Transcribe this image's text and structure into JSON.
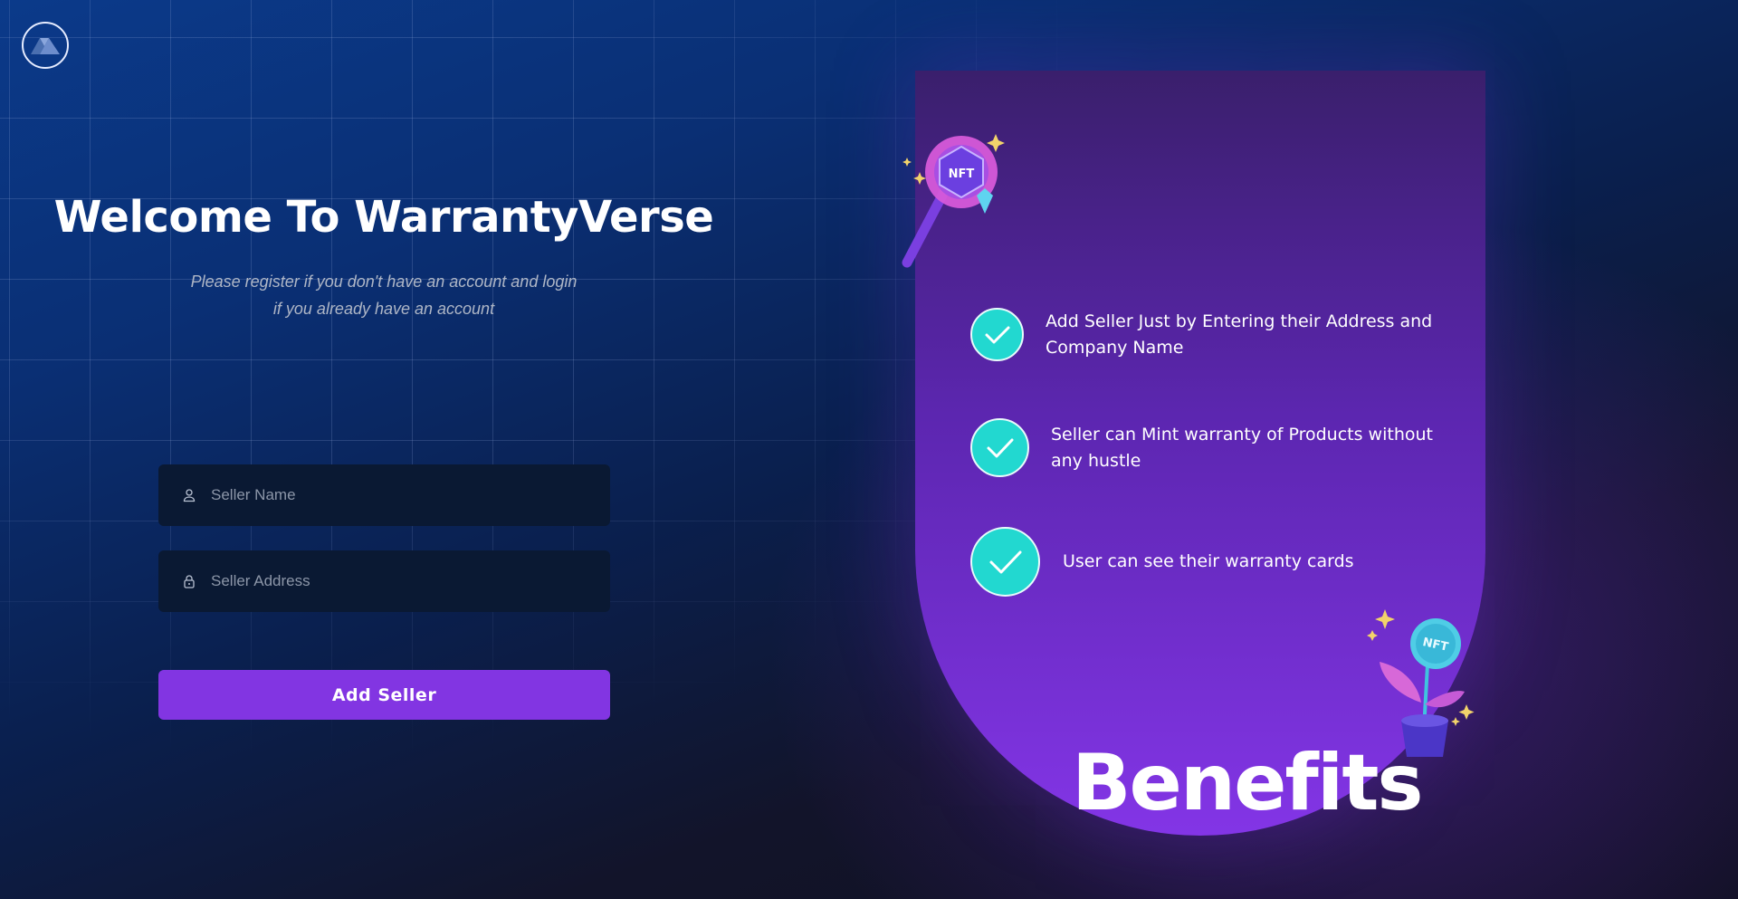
{
  "logo": {
    "icon": "warrantyverse-logo-icon"
  },
  "hero": {
    "title": "Welcome To WarrantyVerse",
    "subtitle": "Please register if you don't have an account and login if you already have an account"
  },
  "form": {
    "seller_name": {
      "placeholder": "Seller Name",
      "value": "",
      "icon": "user-icon"
    },
    "seller_address": {
      "placeholder": "Seller Address",
      "value": "",
      "icon": "lock-icon"
    },
    "submit_label": "Add Seller"
  },
  "benefits": {
    "title": "Benefits",
    "items": [
      {
        "text": "Add Seller Just by Entering their Address and Company Name",
        "icon": "check-icon"
      },
      {
        "text": "Seller can Mint warranty of Products without any hustle",
        "icon": "check-icon"
      },
      {
        "text": "User can see their warranty cards",
        "icon": "check-icon"
      }
    ],
    "decor": {
      "magnifier_badge": "NFT",
      "plant_badge": "NFT"
    }
  },
  "colors": {
    "accent": "#8235e2",
    "check": "#22d8d0",
    "field_bg": "#0a1933",
    "panel_bottom": "#8335e6"
  }
}
